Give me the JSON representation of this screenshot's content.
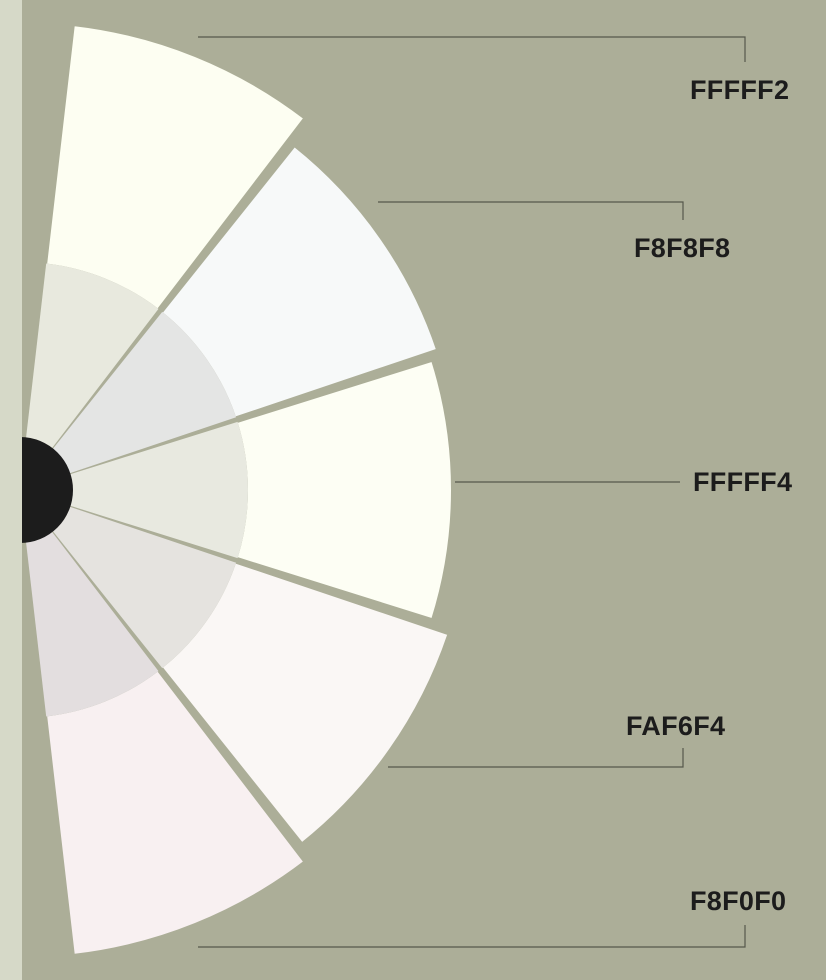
{
  "background_color": "#acae98",
  "edge_strip_color": "#d6d9c8",
  "hub_color": "#1c1c1c",
  "leader_color": "#55574b",
  "separator_color": "#acae98",
  "swatches": [
    {
      "label": "FFFFF2",
      "outer_color": "#fdfef2",
      "inner_color": "#e8e9de"
    },
    {
      "label": "F8F8F8",
      "outer_color": "#f7f9f9",
      "inner_color": "#e4e5e4"
    },
    {
      "label": "FFFFF4",
      "outer_color": "#fdfef4",
      "inner_color": "#e8e9e0"
    },
    {
      "label": "FAF6F4",
      "outer_color": "#faf7f5",
      "inner_color": "#e5e3df"
    },
    {
      "label": "F8F0F0",
      "outer_color": "#f8f0f1",
      "inner_color": "#e3dedf"
    }
  ]
}
